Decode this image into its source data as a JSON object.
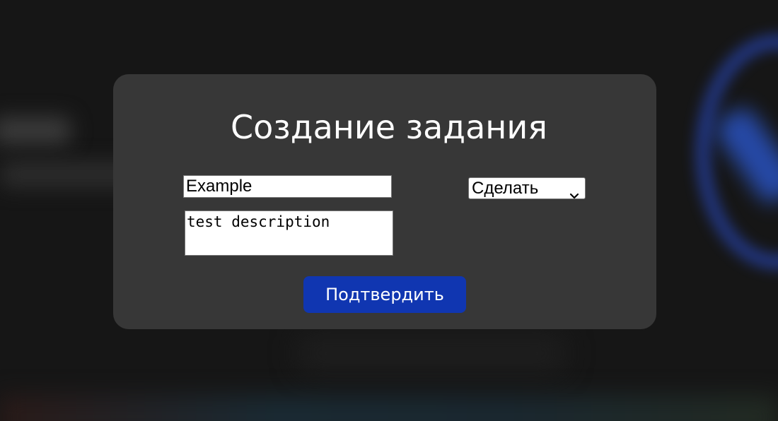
{
  "dialog": {
    "title": "Создание задания",
    "task_title_input": {
      "value": "Example"
    },
    "task_description_input": {
      "value": "test description"
    },
    "status_select": {
      "selected": "Сделать"
    },
    "submit_label": "Подтвердить"
  },
  "colors": {
    "dialog_background": "#373737",
    "page_background": "#161616",
    "submit_button": "#1036b1"
  },
  "icons": {
    "select_arrow": "chevron-down-icon"
  }
}
